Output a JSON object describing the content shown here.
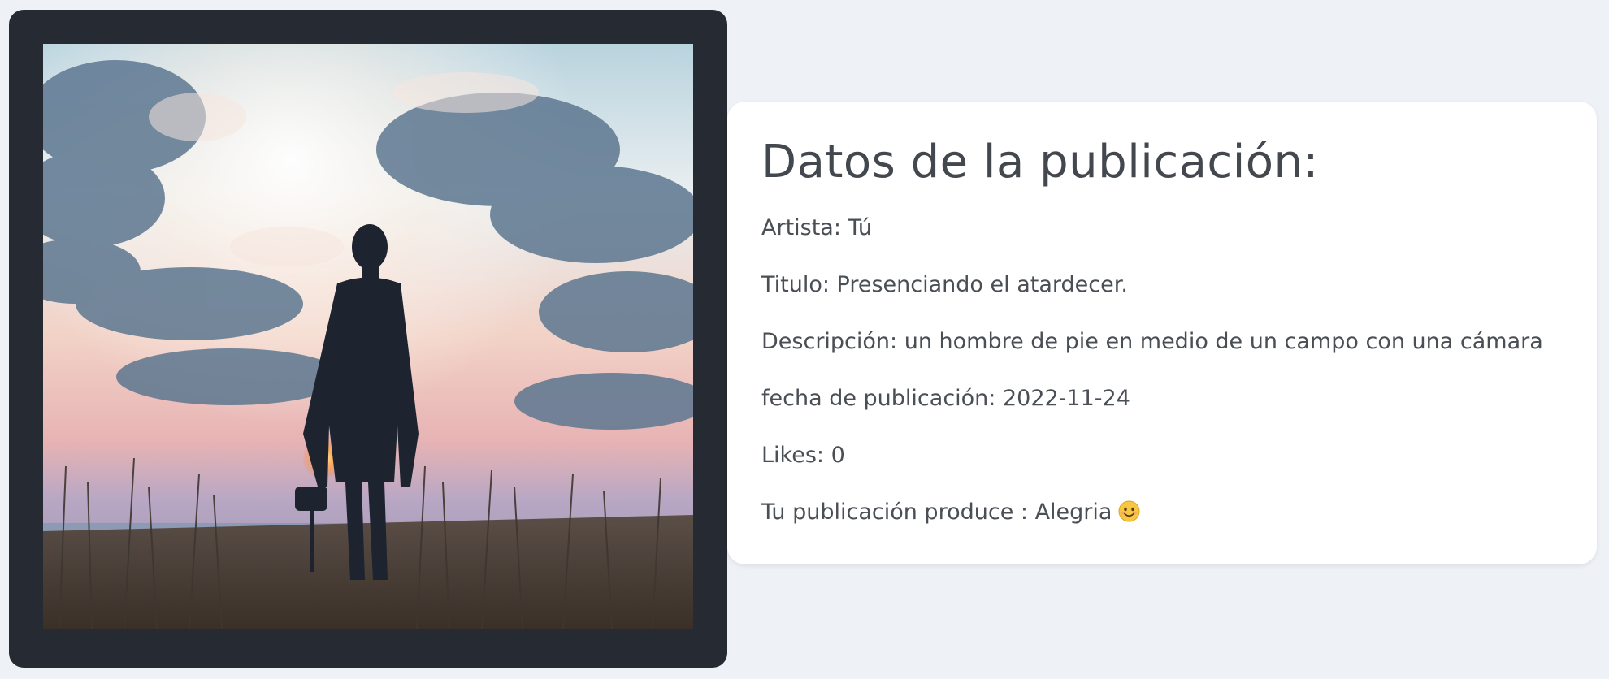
{
  "image": {
    "alt": "un hombre de pie en medio de un campo con una cámara",
    "icon": "photo-landscape"
  },
  "details": {
    "title": "Datos de la publicación:",
    "artist": "Artista: Tú",
    "post_title": "Titulo: Presenciando el atardecer.",
    "description": "Descripción: un hombre de pie en medio de un campo con una cámara",
    "date": "fecha de publicación: 2022-11-24",
    "likes": "Likes: 0",
    "mood": "Tu publicación produce : Alegria",
    "mood_icon": "smiling-face-emoji"
  },
  "colors": {
    "page_bg": "#eef1f5",
    "image_card_bg": "#262a32",
    "text": "#4a4e55"
  }
}
